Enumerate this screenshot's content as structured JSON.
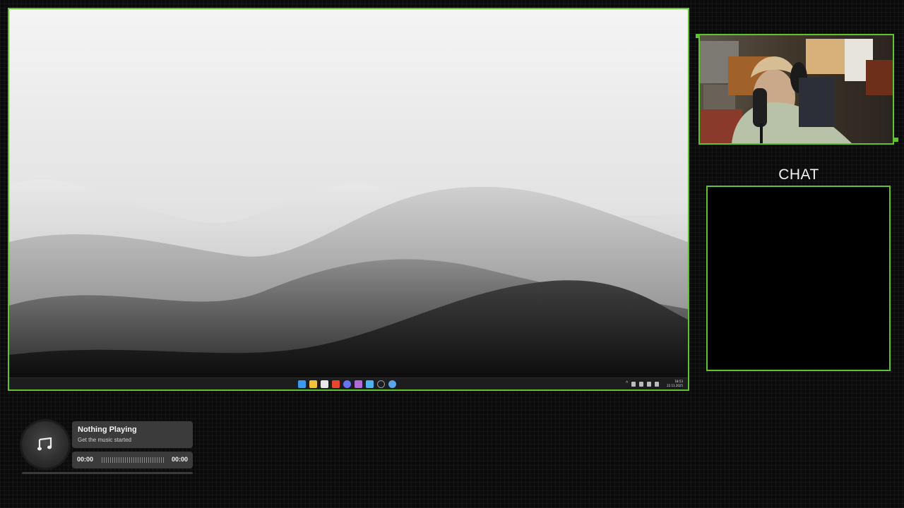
{
  "screen": {
    "taskbar": {
      "apps": [
        {
          "icon": "start-windows-icon",
          "color": "#3a9bf0"
        },
        {
          "icon": "file-explorer-icon",
          "color": "#f3c23a"
        },
        {
          "icon": "notepad-icon",
          "color": "#e8e8e8"
        },
        {
          "icon": "brave-browser-icon",
          "color": "#e8472e"
        },
        {
          "icon": "discord-icon",
          "color": "#6b74f0"
        },
        {
          "icon": "obs-studio-icon",
          "color": "#b06bd8"
        },
        {
          "icon": "notes-app-icon",
          "color": "#4fb3ee"
        },
        {
          "icon": "clock-app-icon",
          "color": "#9a9a9a"
        },
        {
          "icon": "steam-icon",
          "color": "#5aa6e8"
        }
      ],
      "tray": [
        "chevron-up-icon",
        "sync-icon",
        "microphone-icon",
        "display-icon",
        "battery-icon"
      ],
      "clock_time": "18:53",
      "clock_date": "22.11.2025"
    }
  },
  "chat": {
    "title": "CHAT"
  },
  "music": {
    "title": "Nothing Playing",
    "subtitle": "Get the music started",
    "time_current": "00:00",
    "time_total": "00:00",
    "progress": 0.0
  },
  "colors": {
    "accent": "#5cc52d",
    "card": "#3b3b3b"
  }
}
